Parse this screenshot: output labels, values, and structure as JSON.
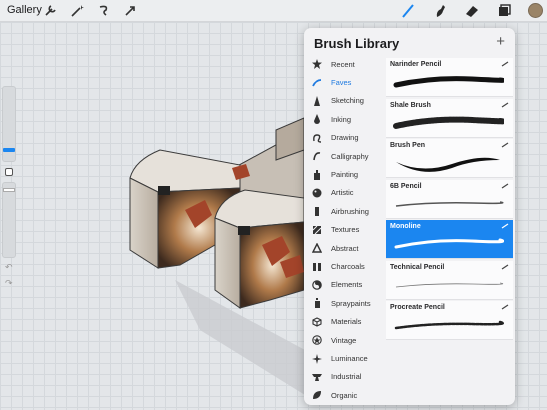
{
  "topbar": {
    "gallery_label": "Gallery",
    "left_tools": [
      "wrench-icon",
      "magic-wand-icon",
      "selection-icon",
      "transform-icon"
    ],
    "right_tools": [
      "brush-icon",
      "smudge-icon",
      "eraser-icon",
      "layers-icon",
      "color-swatch"
    ],
    "active_color": "#9a8467"
  },
  "panel": {
    "title": "Brush Library",
    "add_label": "+",
    "categories": [
      {
        "label": "Recent",
        "icon": "star-icon"
      },
      {
        "label": "Faves",
        "icon": "squiggle-icon",
        "active": true
      },
      {
        "label": "Sketching",
        "icon": "pencil-tip-icon"
      },
      {
        "label": "Inking",
        "icon": "ink-drop-icon"
      },
      {
        "label": "Drawing",
        "icon": "loop-icon"
      },
      {
        "label": "Calligraphy",
        "icon": "calligraphy-icon"
      },
      {
        "label": "Painting",
        "icon": "paint-bucket-icon"
      },
      {
        "label": "Artistic",
        "icon": "palette-icon"
      },
      {
        "label": "Airbrushing",
        "icon": "airbrush-icon"
      },
      {
        "label": "Textures",
        "icon": "texture-icon"
      },
      {
        "label": "Abstract",
        "icon": "triangle-icon"
      },
      {
        "label": "Charcoals",
        "icon": "charcoal-icon"
      },
      {
        "label": "Elements",
        "icon": "yin-yang-icon"
      },
      {
        "label": "Spraypaints",
        "icon": "spray-can-icon"
      },
      {
        "label": "Materials",
        "icon": "cube-icon"
      },
      {
        "label": "Vintage",
        "icon": "vintage-star-icon"
      },
      {
        "label": "Luminance",
        "icon": "sparkle-icon"
      },
      {
        "label": "Industrial",
        "icon": "anvil-icon"
      },
      {
        "label": "Organic",
        "icon": "leaf-icon"
      }
    ],
    "brushes": [
      {
        "name": "Narinder Pencil"
      },
      {
        "name": "Shale Brush"
      },
      {
        "name": "Brush Pen"
      },
      {
        "name": "6B Pencil"
      },
      {
        "name": "Monoline",
        "selected": true
      },
      {
        "name": "Technical Pencil"
      },
      {
        "name": "Procreate Pencil"
      }
    ]
  },
  "colors": {
    "accent": "#1b86f0",
    "panel": "#f2f2f4"
  }
}
